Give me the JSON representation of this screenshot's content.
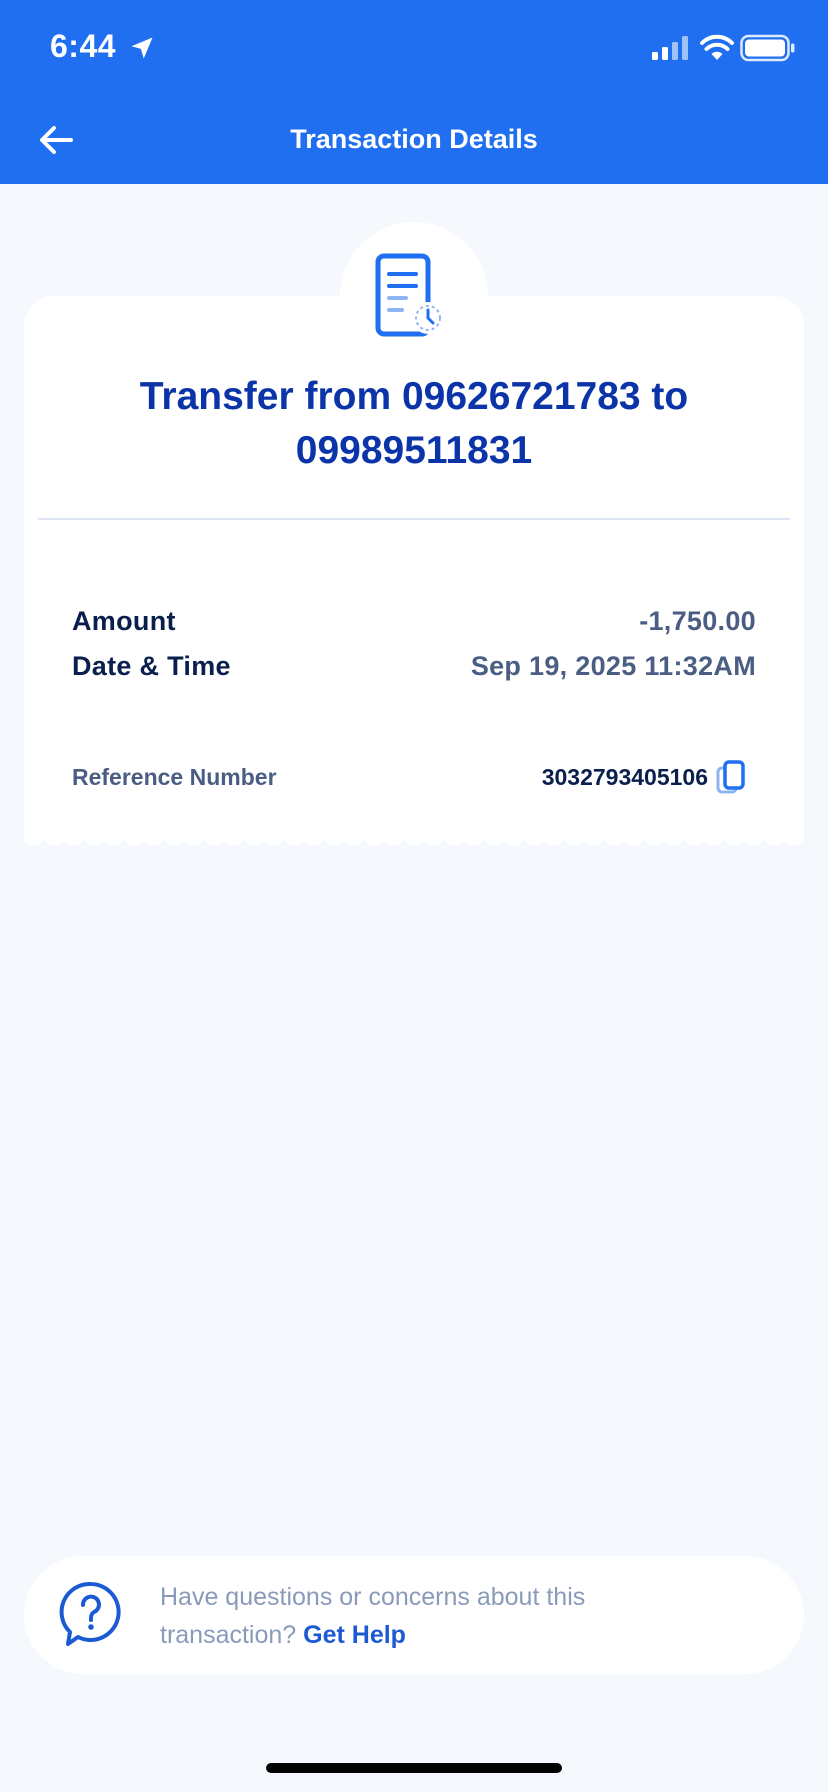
{
  "status_bar": {
    "time": "6:44",
    "icons": [
      "location-arrow-icon",
      "cellular-signal-icon",
      "wifi-icon",
      "battery-icon"
    ]
  },
  "header": {
    "title": "Transaction Details",
    "back_icon": "arrow-left-icon",
    "background_color": "#1f6ff0"
  },
  "transaction": {
    "icon": "receipt-clock-icon",
    "title": "Transfer from 09626721783 to 09989511831",
    "rows": [
      {
        "label": "Amount",
        "value": "-1,750.00"
      },
      {
        "label": "Date & Time",
        "value": "Sep 19, 2025 11:32AM"
      }
    ],
    "reference": {
      "label": "Reference Number",
      "value": "3032793405106",
      "copy_icon": "copy-icon"
    }
  },
  "help": {
    "icon": "question-bubble-icon",
    "text": "Have questions or concerns about this transaction?",
    "link": "Get Help"
  },
  "colors": {
    "accent": "#1f6ff0",
    "heading": "#0b34a8",
    "text_dark": "#0a1f4d",
    "text_muted": "#4a5d82",
    "page_bg": "#f5f8fd"
  }
}
